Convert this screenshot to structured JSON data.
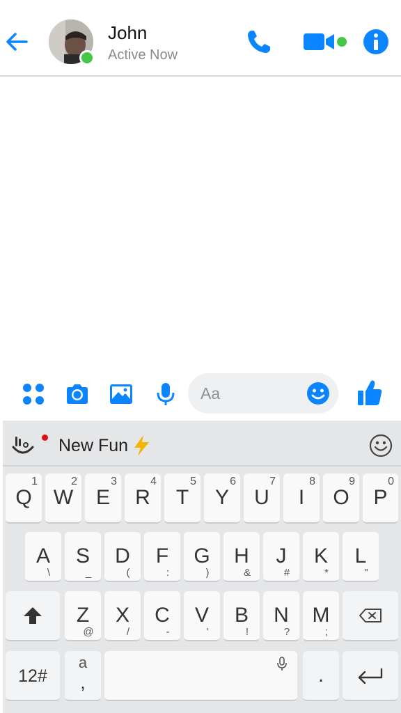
{
  "header": {
    "contact_name": "John",
    "status": "Active Now"
  },
  "composer": {
    "placeholder": "Aa"
  },
  "keyboard": {
    "toolbar_title": "New Fun",
    "row1": [
      {
        "label": "Q",
        "alt": "1"
      },
      {
        "label": "W",
        "alt": "2"
      },
      {
        "label": "E",
        "alt": "3"
      },
      {
        "label": "R",
        "alt": "4"
      },
      {
        "label": "T",
        "alt": "5"
      },
      {
        "label": "Y",
        "alt": "6"
      },
      {
        "label": "U",
        "alt": "7"
      },
      {
        "label": "I",
        "alt": "8"
      },
      {
        "label": "O",
        "alt": "9"
      },
      {
        "label": "P",
        "alt": "0"
      }
    ],
    "row2": [
      {
        "label": "A",
        "alt": "\\"
      },
      {
        "label": "S",
        "alt": "_"
      },
      {
        "label": "D",
        "alt": "("
      },
      {
        "label": "F",
        "alt": ":"
      },
      {
        "label": "G",
        "alt": ")"
      },
      {
        "label": "H",
        "alt": "&"
      },
      {
        "label": "J",
        "alt": "#"
      },
      {
        "label": "K",
        "alt": "*"
      },
      {
        "label": "L",
        "alt": "\""
      }
    ],
    "row3": [
      {
        "label": "Z",
        "alt": "@"
      },
      {
        "label": "X",
        "alt": "/"
      },
      {
        "label": "C",
        "alt": "-"
      },
      {
        "label": "V",
        "alt": "'"
      },
      {
        "label": "B",
        "alt": "!"
      },
      {
        "label": "N",
        "alt": "?"
      },
      {
        "label": "M",
        "alt": ";"
      }
    ],
    "numbers_key": "12#",
    "a_key": "a",
    "a_key_alt": ",",
    "period_key": "."
  },
  "colors": {
    "accent": "#0a84ff",
    "presence": "#44c744",
    "keyboard_bg": "#e4e6e8",
    "key_bg": "#f9f9f9"
  }
}
